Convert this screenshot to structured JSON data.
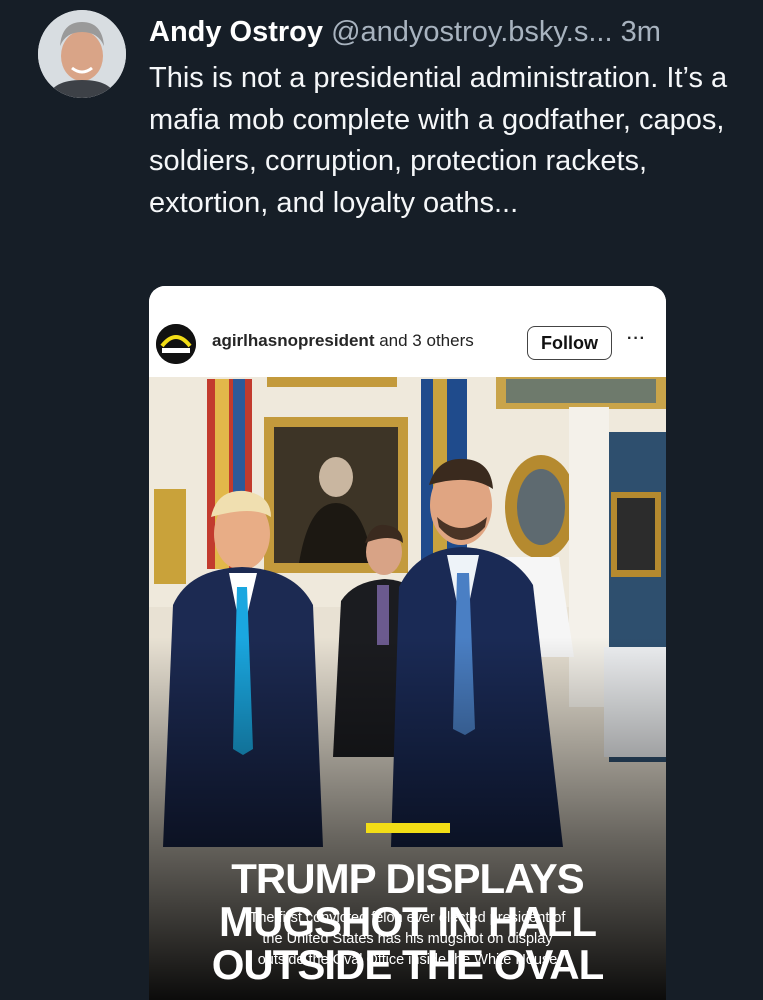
{
  "post": {
    "author_name": "Andy Ostroy",
    "handle": "@andyostroy.bsky.s...",
    "time": "3m",
    "text": "This is not a presidential administration. It’s a mafia mob complete with a godfather, capos, soldiers, corruption, protection rackets, extortion, and loyalty oaths..."
  },
  "embed": {
    "account": "agirlhasnopresident",
    "others": "and 3 others",
    "follow_label": "Follow",
    "more_label": "···",
    "headline": [
      "TRUMP DISPLAYS",
      "MUGSHOT IN HALL",
      "OUTSIDE THE OVAL"
    ],
    "subtitle": [
      "The first convicted felon ever elected president of",
      "the United States has his mugshot on display",
      "outside the Oval Office inside the White House"
    ]
  },
  "colors": {
    "background": "#161e27",
    "accent_yellow": "#f2dd16"
  }
}
